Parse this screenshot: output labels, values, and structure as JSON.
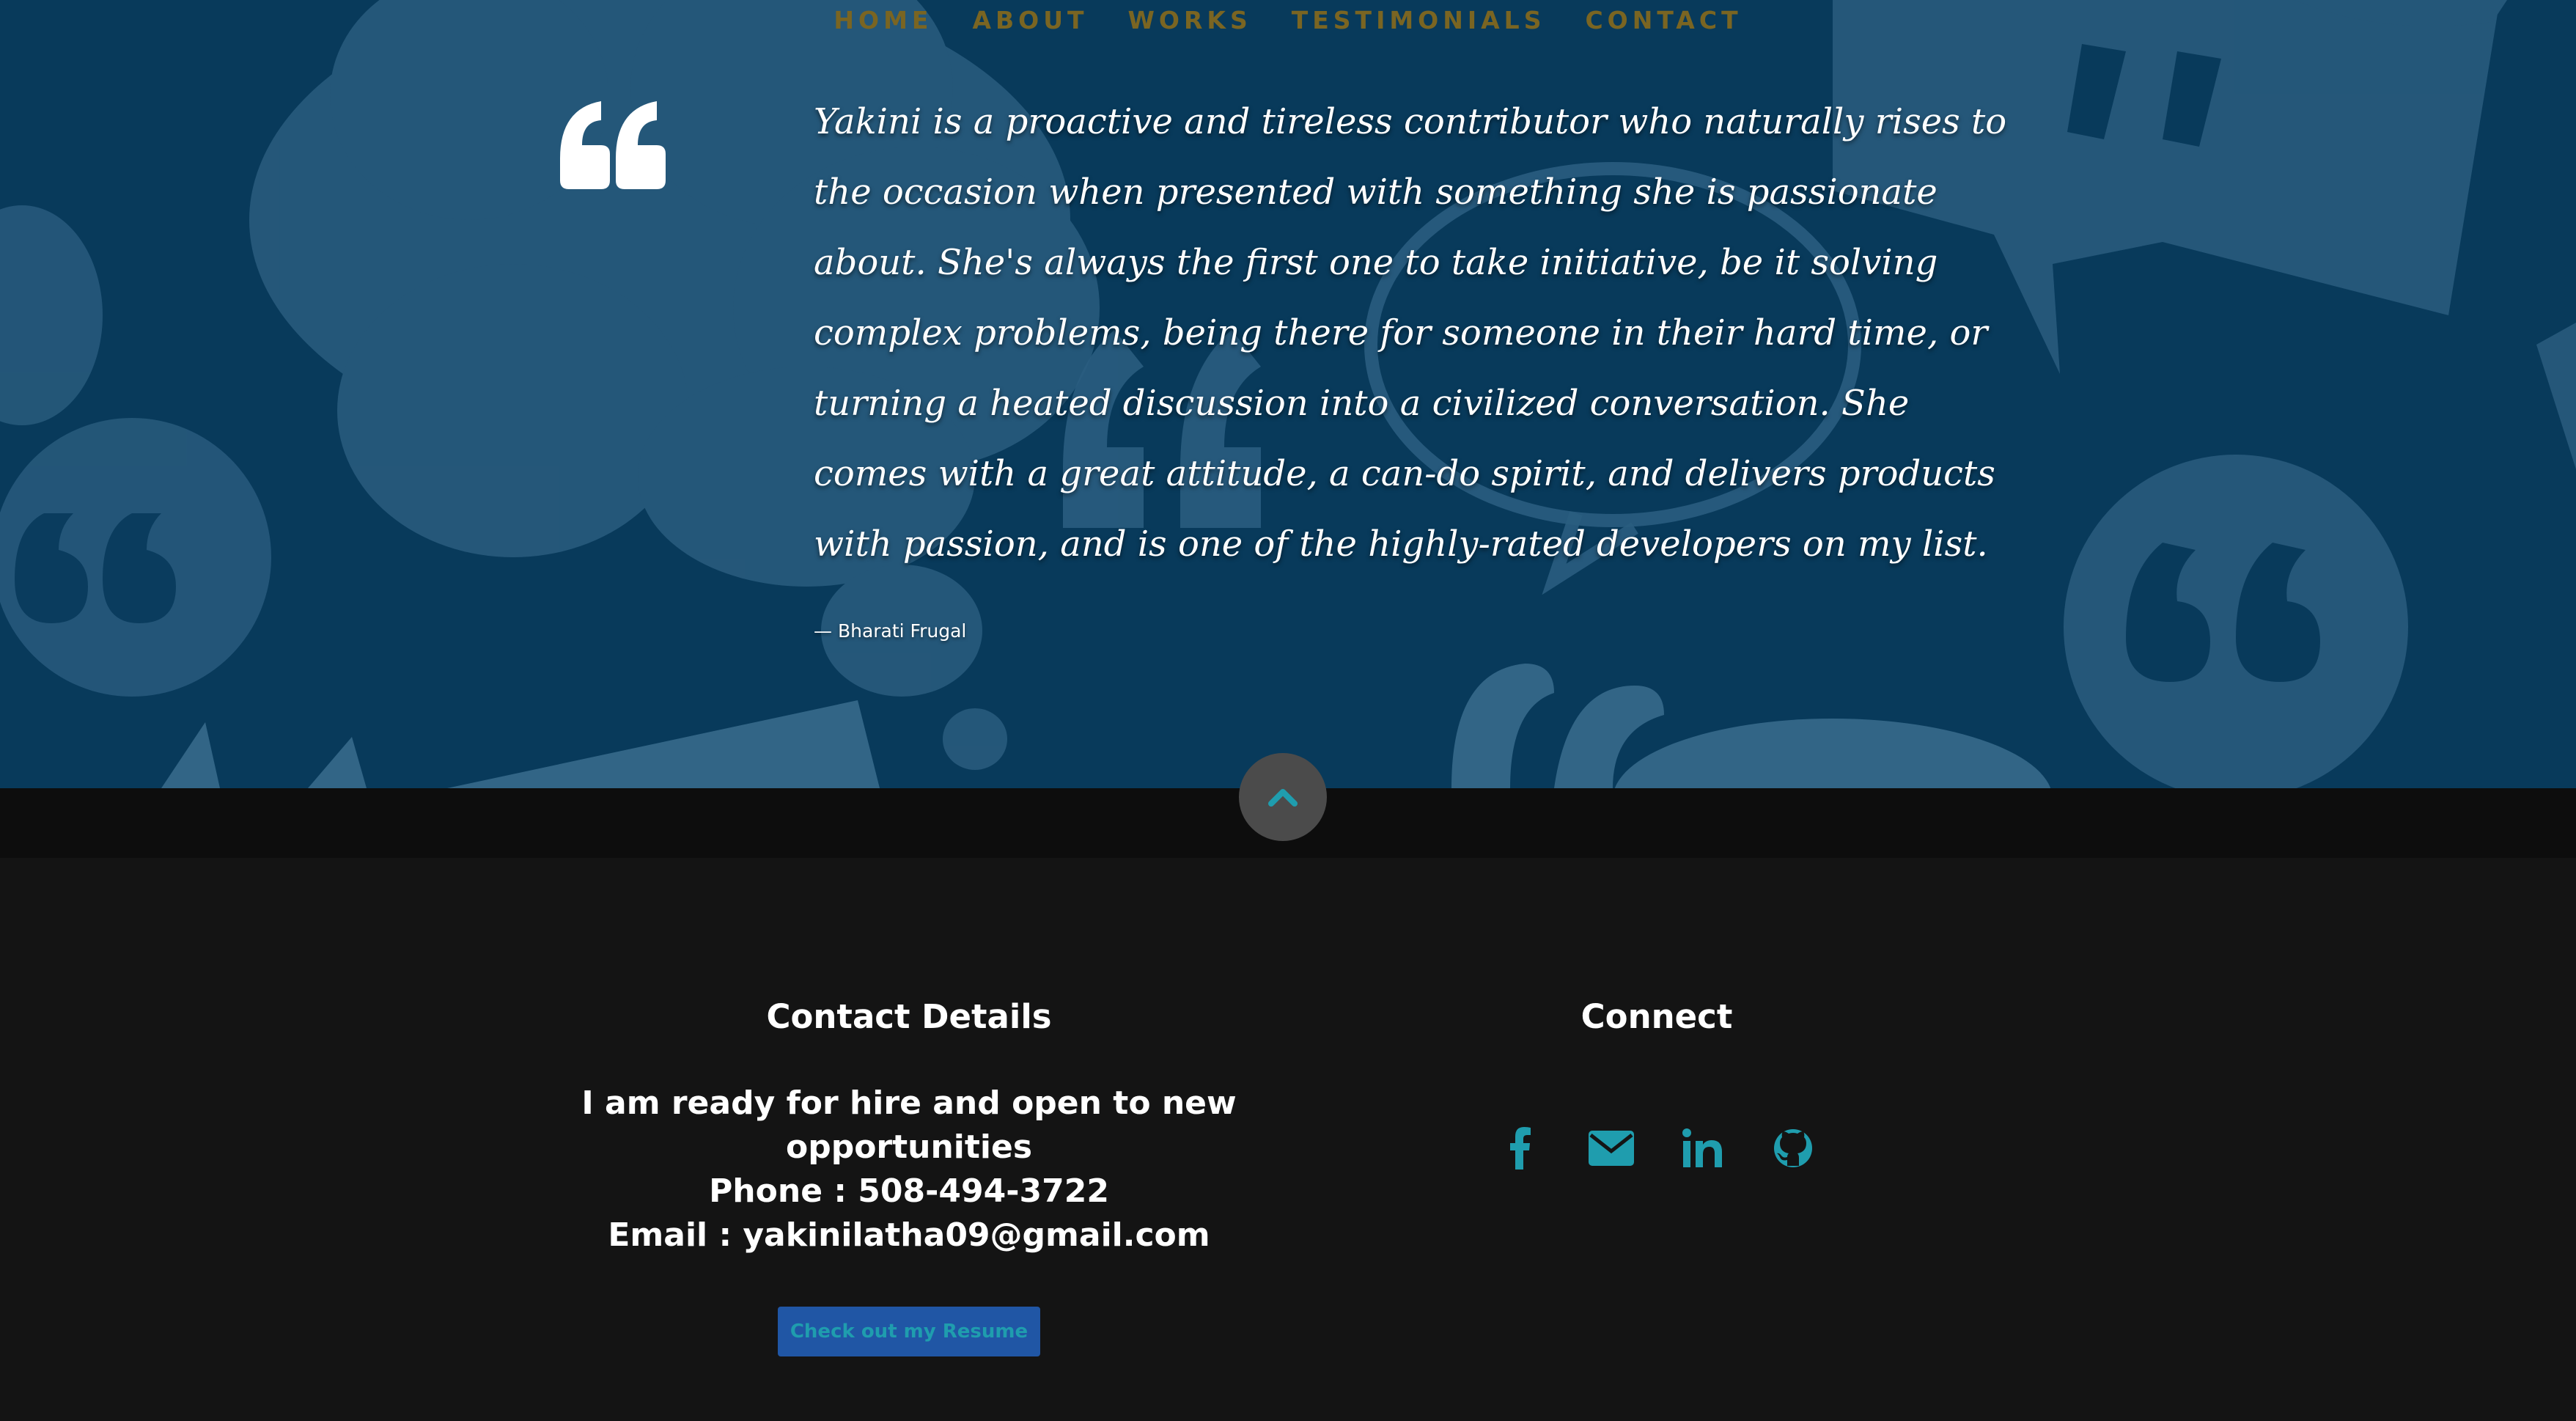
{
  "nav": {
    "items": [
      "HOME",
      "ABOUT",
      "WORKS",
      "TESTIMONIALS",
      "CONTACT"
    ]
  },
  "testimonial": {
    "quote": "Yakini is a proactive and tireless contributor who naturally rises to the occasion when presented with something she is passionate about. She's always the first one to take initiative, be it solving complex problems, being there for someone in their hard time, or turning a heated discussion into a civilized conversation. She comes with a great attitude, a can-do spirit, and delivers products with passion, and is one of the highly-rated developers on my list.",
    "author": "— Bharati Frugal"
  },
  "contact": {
    "title": "Contact Details",
    "line1": "I am ready for hire and open to new",
    "line2": "opportunities",
    "phone": "Phone : 508-494-3722",
    "email": "Email : yakinilatha09@gmail.com",
    "resume_label": "Check out my Resume"
  },
  "connect": {
    "title": "Connect",
    "icons": [
      "facebook-icon",
      "email-icon",
      "linkedin-icon",
      "github-icon"
    ]
  },
  "colors": {
    "testimonial_bg": "#083a5b",
    "nav_text": "#7a6522",
    "accent": "#1f9dae",
    "footer_bg": "#141414",
    "button_bg": "#2056a5"
  }
}
